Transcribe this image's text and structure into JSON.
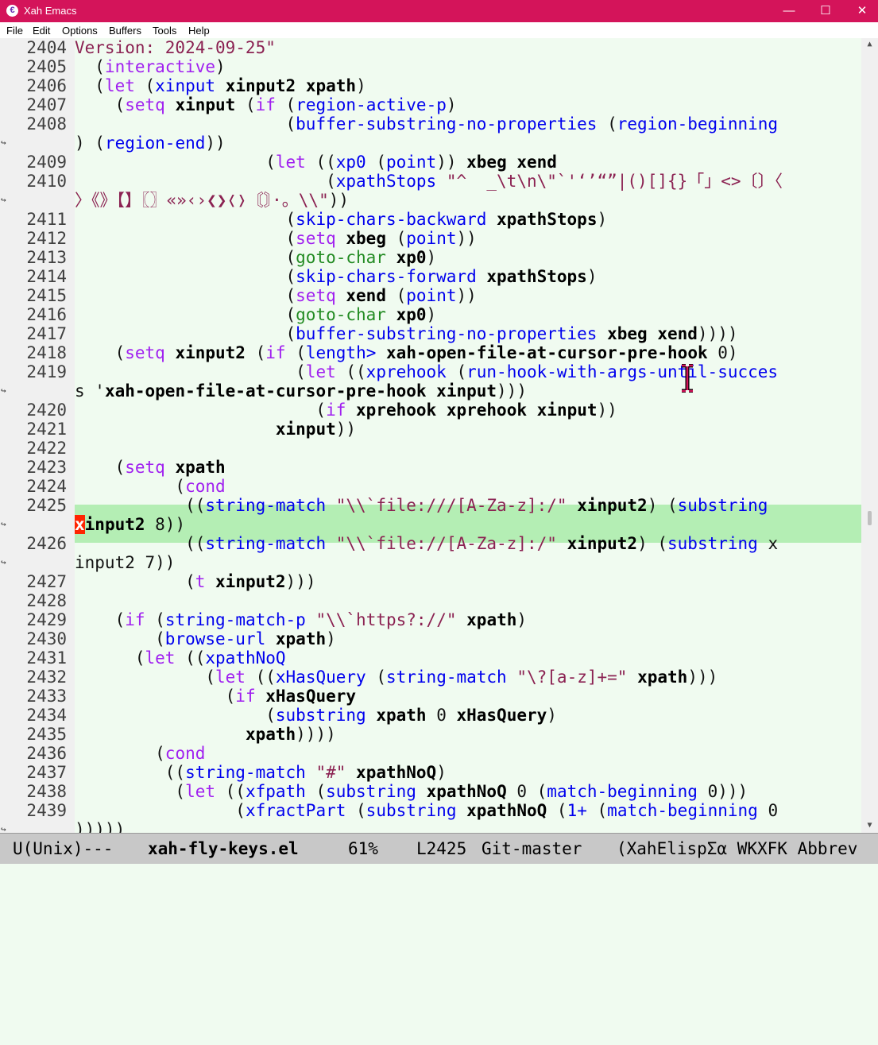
{
  "window": {
    "title": "Xah Emacs",
    "app_icon_glyph": "€",
    "minimize_glyph": "—",
    "maximize_glyph": "☐",
    "close_glyph": "✕"
  },
  "menu": [
    "File",
    "Edit",
    "Options",
    "Buffers",
    "Tools",
    "Help"
  ],
  "lines": [
    {
      "n": "2404",
      "text": "Version: 2024-09-25\""
    },
    {
      "n": "2405",
      "text": "  (interactive)"
    },
    {
      "n": "2406",
      "text": "  (let (xinput xinput2 xpath)"
    },
    {
      "n": "2407",
      "text": "    (setq xinput (if (region-active-p)"
    },
    {
      "n": "2408",
      "text": "                     (buffer-substring-no-properties (region-beginning"
    },
    {
      "n": "",
      "text": ") (region-end))"
    },
    {
      "n": "2409",
      "text": "                   (let ((xp0 (point)) xbeg xend"
    },
    {
      "n": "2410",
      "text": "                         (xpathStops \"^  _\\t\\n\\\"`'‘’“”|()[]{}「」<>〔〕〈"
    },
    {
      "n": "",
      "text": "〉《》【】〖〗«»‹›❮❯❬❭〘〙·。\\\\\"))"
    },
    {
      "n": "2411",
      "text": "                     (skip-chars-backward xpathStops)"
    },
    {
      "n": "2412",
      "text": "                     (setq xbeg (point))"
    },
    {
      "n": "2413",
      "text": "                     (goto-char xp0)"
    },
    {
      "n": "2414",
      "text": "                     (skip-chars-forward xpathStops)"
    },
    {
      "n": "2415",
      "text": "                     (setq xend (point))"
    },
    {
      "n": "2416",
      "text": "                     (goto-char xp0)"
    },
    {
      "n": "2417",
      "text": "                     (buffer-substring-no-properties xbeg xend))))"
    },
    {
      "n": "2418",
      "text": "    (setq xinput2 (if (length> xah-open-file-at-cursor-pre-hook 0)"
    },
    {
      "n": "2419",
      "text": "                      (let ((xprehook (run-hook-with-args-until-succes"
    },
    {
      "n": "",
      "text": "s 'xah-open-file-at-cursor-pre-hook xinput)))"
    },
    {
      "n": "2420",
      "text": "                        (if xprehook xprehook xinput))"
    },
    {
      "n": "2421",
      "text": "                    xinput))"
    },
    {
      "n": "2422",
      "text": ""
    },
    {
      "n": "2423",
      "text": "    (setq xpath"
    },
    {
      "n": "2424",
      "text": "          (cond"
    },
    {
      "n": "2425",
      "text": "           ((string-match \"\\\\`file:///[A-Za-z]:/\" xinput2) (substring"
    },
    {
      "n": "",
      "text": "xinput2 8))"
    },
    {
      "n": "2426",
      "text": "           ((string-match \"\\\\`file://[A-Za-z]:/\" xinput2) (substring x"
    },
    {
      "n": "",
      "text": "input2 7))"
    },
    {
      "n": "2427",
      "text": "           (t xinput2)))"
    },
    {
      "n": "2428",
      "text": ""
    },
    {
      "n": "2429",
      "text": "    (if (string-match-p \"\\\\`https?://\" xpath)"
    },
    {
      "n": "2430",
      "text": "        (browse-url xpath)"
    },
    {
      "n": "2431",
      "text": "      (let ((xpathNoQ"
    },
    {
      "n": "2432",
      "text": "             (let ((xHasQuery (string-match \"\\?[a-z]+=\" xpath)))"
    },
    {
      "n": "2433",
      "text": "               (if xHasQuery"
    },
    {
      "n": "2434",
      "text": "                   (substring xpath 0 xHasQuery)"
    },
    {
      "n": "2435",
      "text": "                 xpath))))"
    },
    {
      "n": "2436",
      "text": "        (cond"
    },
    {
      "n": "2437",
      "text": "         ((string-match \"#\" xpathNoQ)"
    },
    {
      "n": "2438",
      "text": "          (let ((xfpath (substring xpathNoQ 0 (match-beginning 0)))"
    },
    {
      "n": "2439",
      "text": "                (xfractPart (substring xpathNoQ (1+ (match-beginning 0"
    },
    {
      "n": "",
      "text": ")))))"
    }
  ],
  "modeline": {
    "status": "U(Unix)---",
    "buffer_name": "xah-fly-keys.el",
    "position_percent": "61%",
    "line": "L2425",
    "vc": "Git-master",
    "modes": "(XahElispΣα WKXFK Abbrev"
  }
}
